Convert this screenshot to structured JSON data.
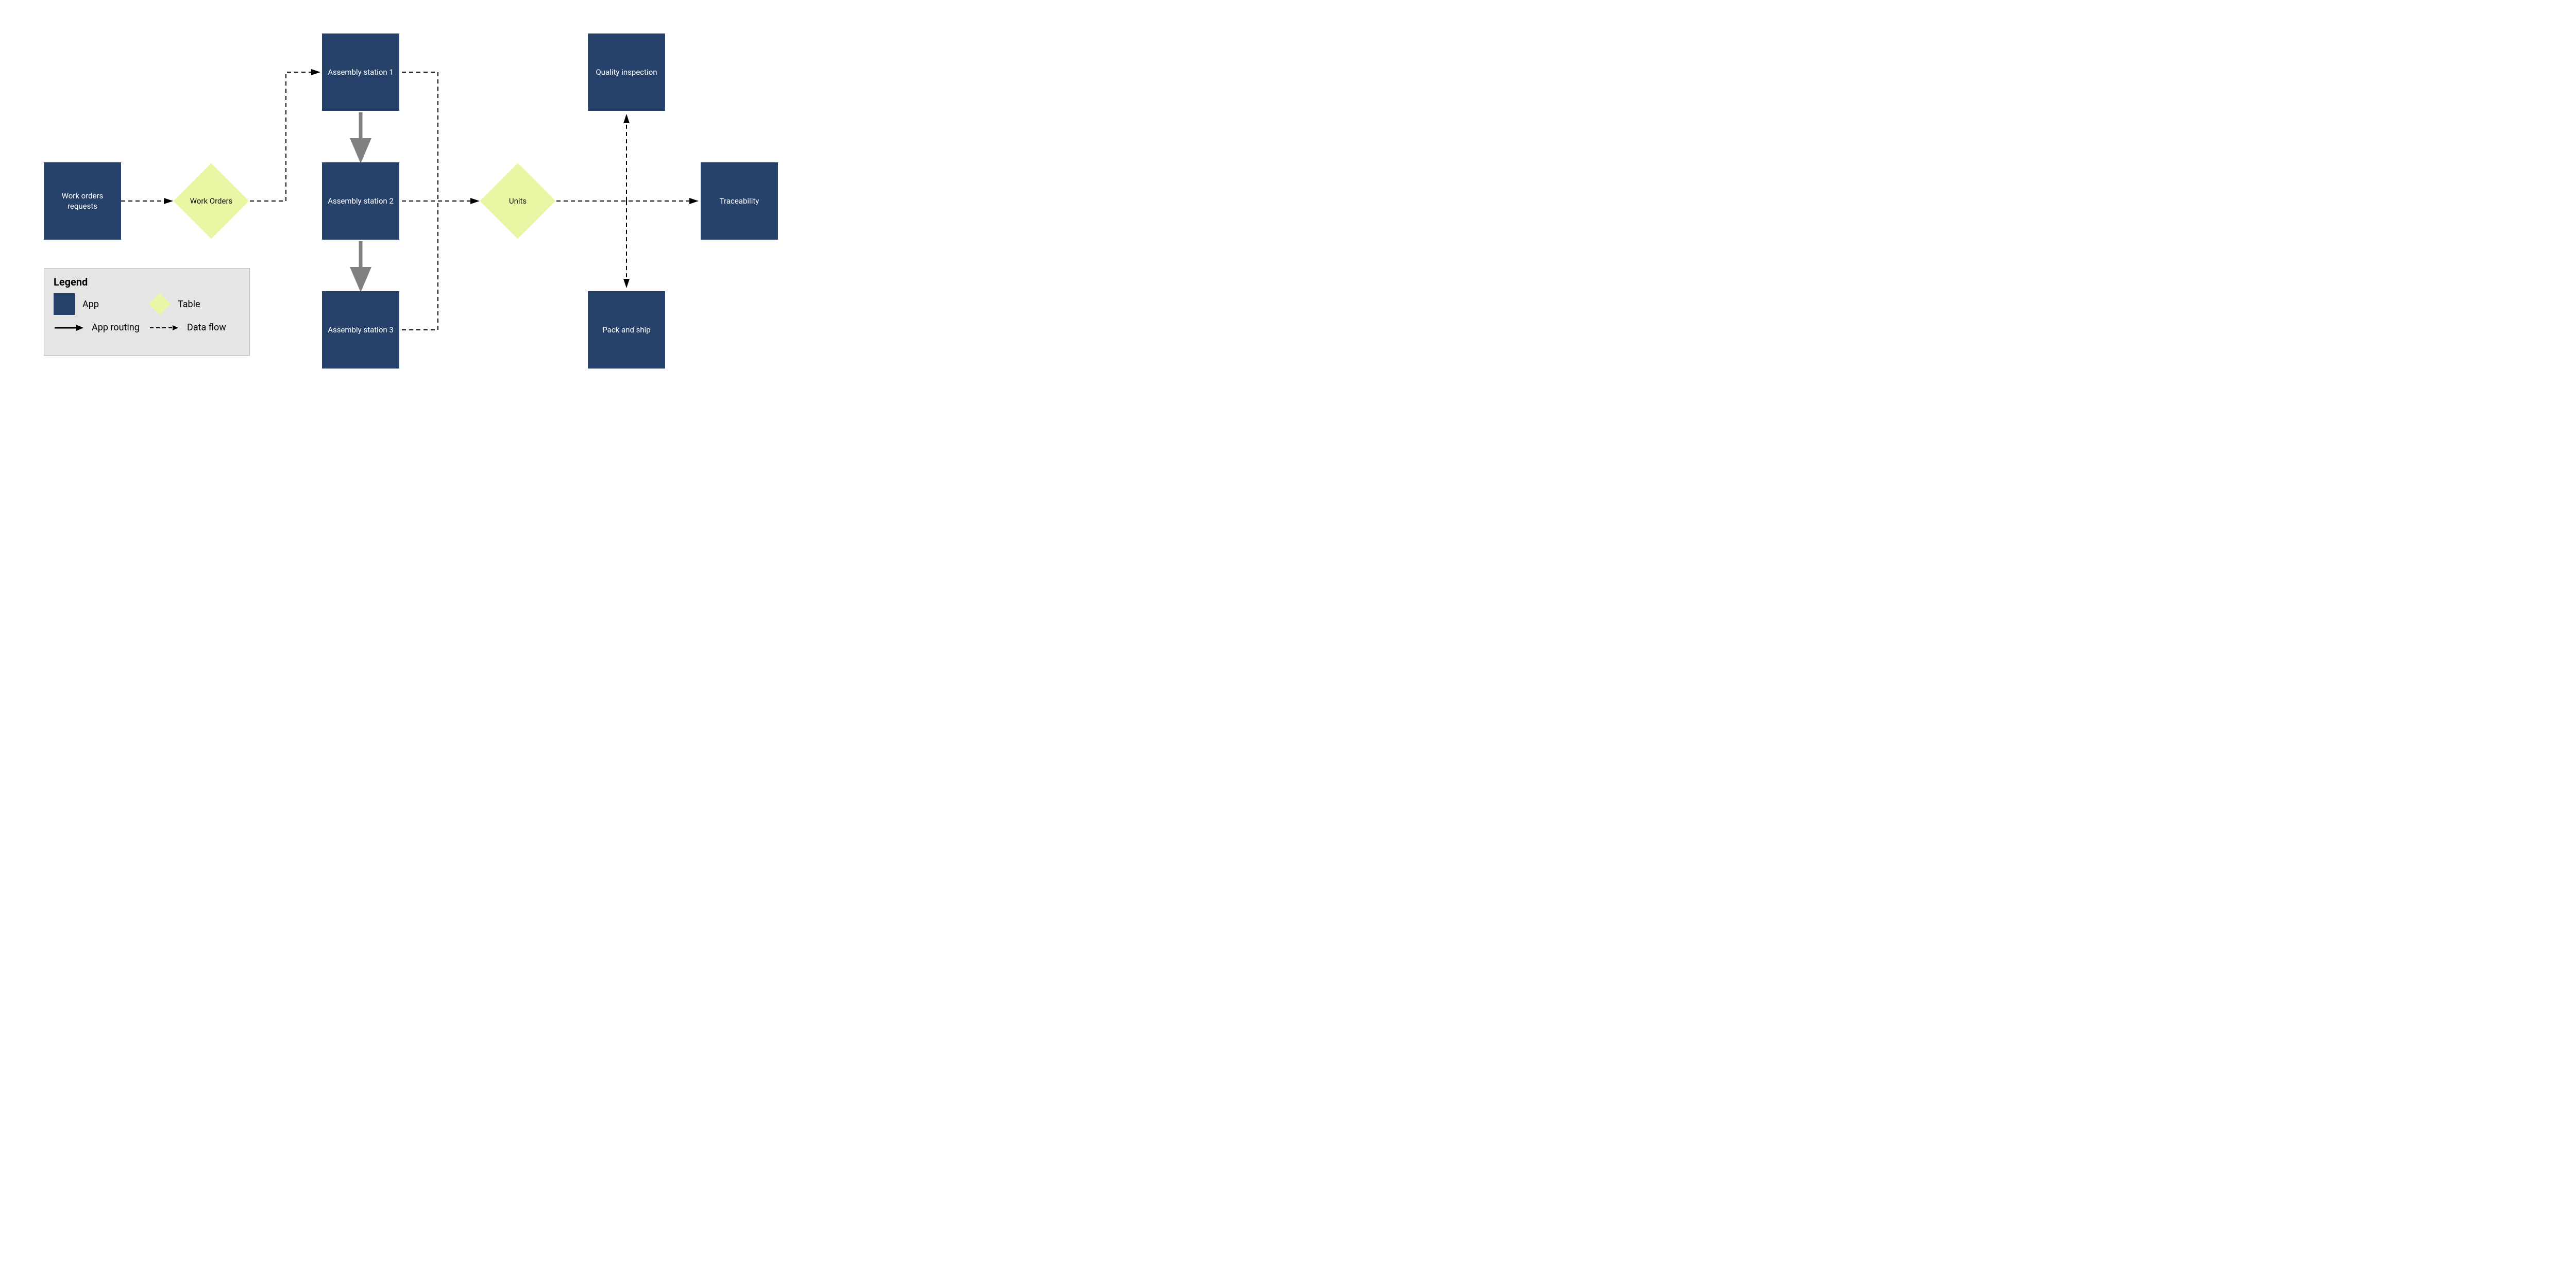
{
  "colors": {
    "app_bg": "#26416a",
    "app_text": "#ffffff",
    "table_bg": "#ebf6a5",
    "table_text": "#111111",
    "legend_bg": "#e5e5e5",
    "legend_border": "#bdbdbd",
    "app_routing_arrow": "#808080",
    "data_flow_arrow": "#000000"
  },
  "nodes": {
    "work_orders_requests": {
      "label": "Work orders requests",
      "type": "app"
    },
    "work_orders_table": {
      "label": "Work Orders",
      "type": "table"
    },
    "assembly_1": {
      "label": "Assembly station 1",
      "type": "app"
    },
    "assembly_2": {
      "label": "Assembly station 2",
      "type": "app"
    },
    "assembly_3": {
      "label": "Assembly station 3",
      "type": "app"
    },
    "units_table": {
      "label": "Units",
      "type": "table"
    },
    "quality_inspection": {
      "label": "Quality inspection",
      "type": "app"
    },
    "traceability": {
      "label": "Traceability",
      "type": "app"
    },
    "pack_and_ship": {
      "label": "Pack and ship",
      "type": "app"
    }
  },
  "edges": [
    {
      "from": "work_orders_requests",
      "to": "work_orders_table",
      "kind": "data_flow"
    },
    {
      "from": "work_orders_table",
      "to": "assembly_1",
      "kind": "data_flow"
    },
    {
      "from": "assembly_1",
      "to": "assembly_2",
      "kind": "app_routing"
    },
    {
      "from": "assembly_2",
      "to": "assembly_3",
      "kind": "app_routing"
    },
    {
      "from": "assembly_2",
      "to": "units_table",
      "kind": "data_flow"
    },
    {
      "from": "assembly_3",
      "to": "units_table",
      "kind": "data_flow"
    },
    {
      "from": "assembly_1",
      "to": "units_table",
      "kind": "data_flow"
    },
    {
      "from": "units_table",
      "to": "traceability",
      "kind": "data_flow"
    },
    {
      "from": "units_table",
      "to": "quality_inspection",
      "kind": "data_flow"
    },
    {
      "from": "units_table",
      "to": "pack_and_ship",
      "kind": "data_flow"
    }
  ],
  "legend": {
    "title": "Legend",
    "app": "App",
    "table": "Table",
    "app_routing": "App routing",
    "data_flow": "Data flow"
  }
}
